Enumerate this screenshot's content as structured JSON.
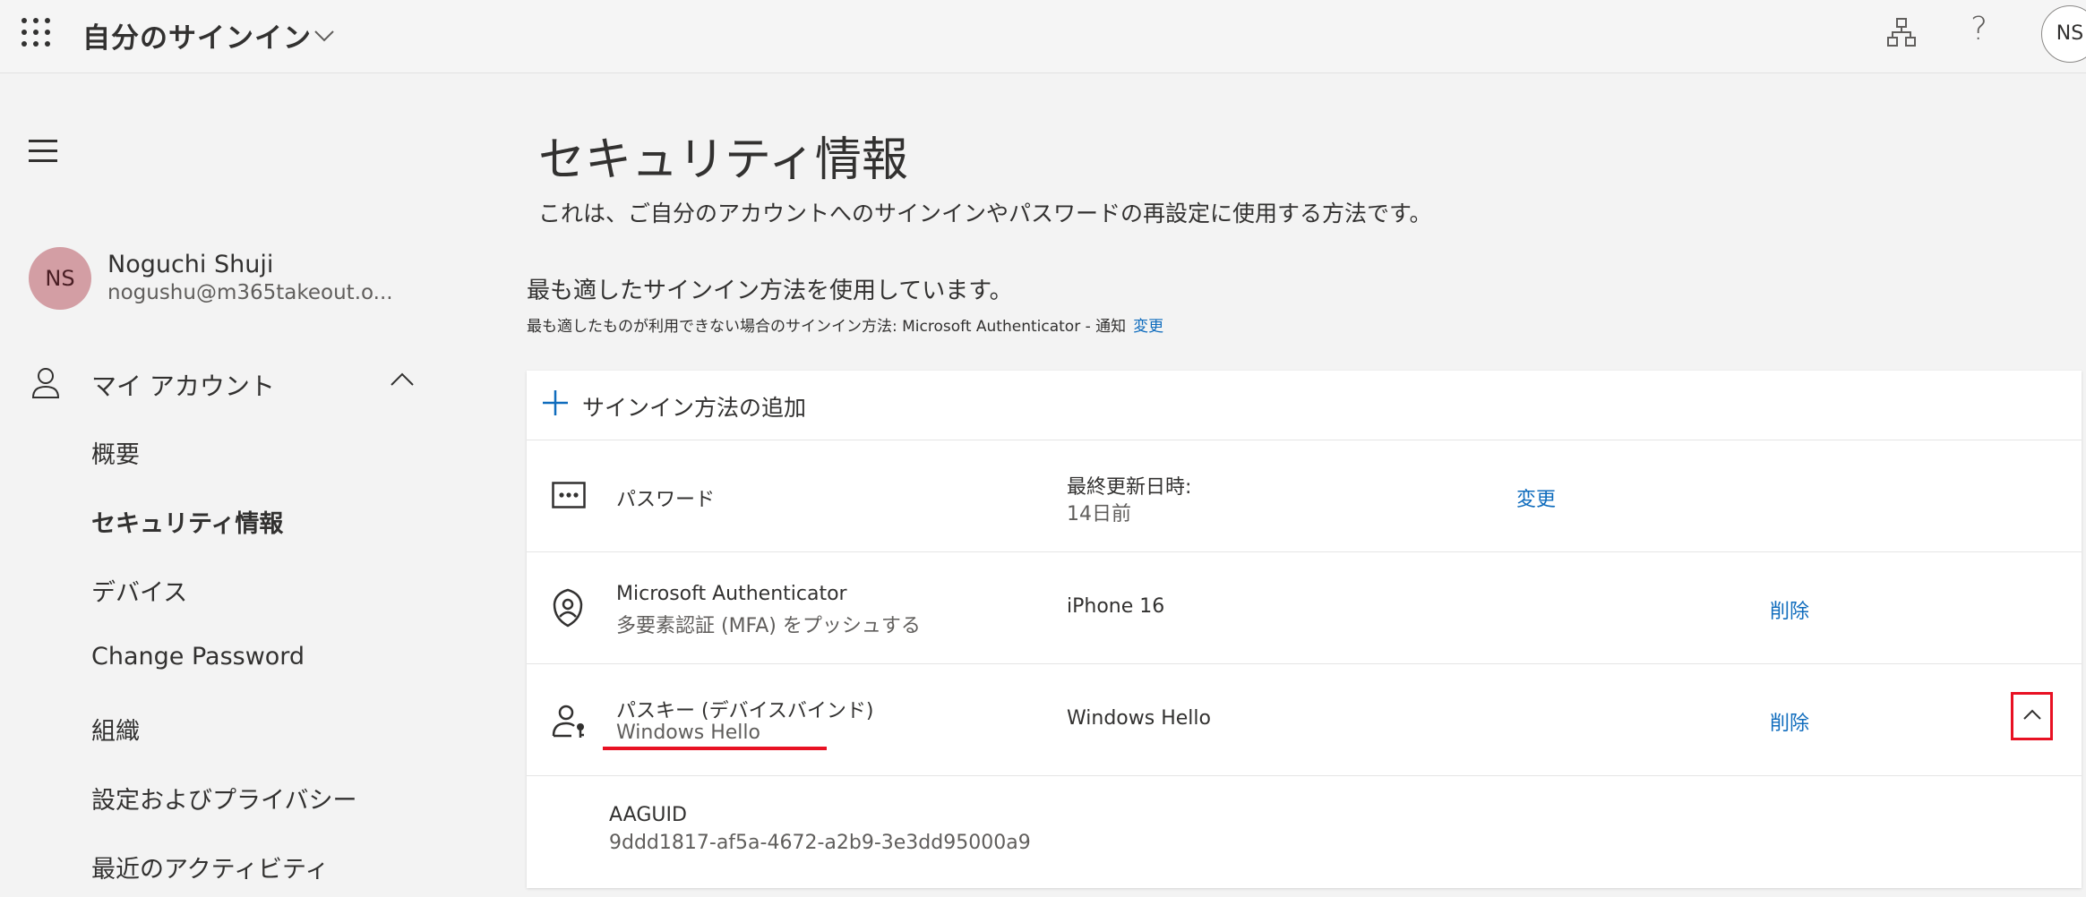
{
  "header": {
    "app_title": "自分のサインイン",
    "avatar_initials": "NS",
    "help_symbol": "?"
  },
  "sidebar": {
    "user": {
      "initials": "NS",
      "name": "Noguchi Shuji",
      "email": "nogushu@m365takeout.o..."
    },
    "section_label": "マイ アカウント",
    "items": [
      {
        "label": "概要",
        "active": false
      },
      {
        "label": "セキュリティ情報",
        "active": true
      },
      {
        "label": "デバイス",
        "active": false
      },
      {
        "label": "Change Password",
        "active": false
      },
      {
        "label": "組織",
        "active": false
      },
      {
        "label": "設定およびプライバシー",
        "active": false
      },
      {
        "label": "最近のアクティビティ",
        "active": false
      }
    ]
  },
  "main": {
    "title": "セキュリティ情報",
    "description": "これは、ご自分のアカウントへのサインインやパスワードの再設定に使用する方法です。",
    "best_method": "最も適したサインイン方法を使用しています。",
    "fallback_text": "最も適したものが利用できない場合のサインイン方法: Microsoft Authenticator - 通知",
    "fallback_link": "変更",
    "add_method_label": "サインイン方法の追加",
    "methods": [
      {
        "name": "パスワード",
        "detail_label": "最終更新日時:",
        "detail_value": "14日前",
        "action": "変更"
      },
      {
        "name": "Microsoft Authenticator",
        "sub": "多要素認証 (MFA) をプッシュする",
        "detail": "iPhone 16",
        "action": "削除"
      },
      {
        "name": "パスキー (デバイスバインド)",
        "sub": "Windows Hello",
        "detail": "Windows Hello",
        "action": "削除",
        "expanded": true
      }
    ],
    "aaguid_label": "AAGUID",
    "aaguid_value": "9ddd1817-af5a-4672-a2b9-3e3dd95000a9"
  },
  "colors": {
    "link": "#0f6cbd",
    "highlight": "#e81123",
    "avatar_bg": "#d39ea4"
  },
  "icons": [
    "waffle-icon",
    "chevron-down-icon",
    "org-chart-icon",
    "help-icon",
    "hamburger-icon",
    "person-icon",
    "chevron-up-icon",
    "plus-icon",
    "password-icon",
    "authenticator-icon",
    "passkey-icon"
  ]
}
